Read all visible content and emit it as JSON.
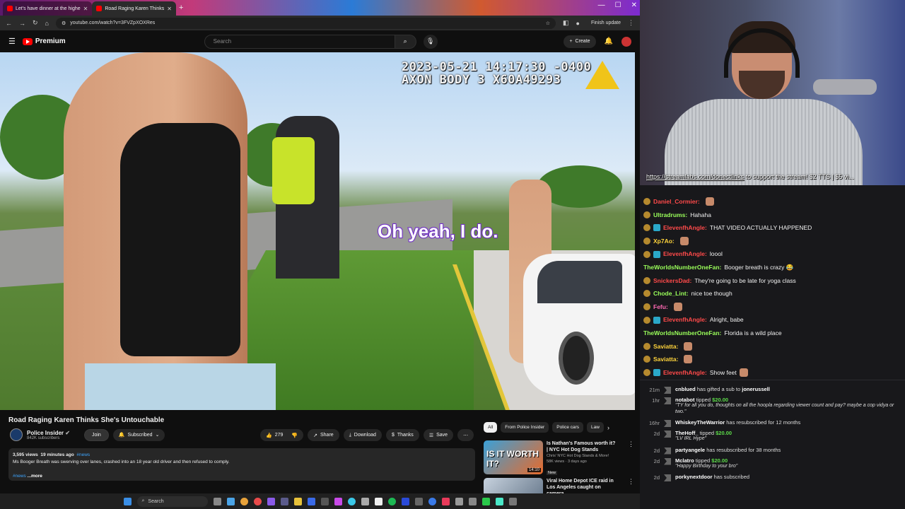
{
  "browser": {
    "tabs": [
      {
        "label": "Let's have dinner at the highe"
      },
      {
        "label": "Road Raging Karen Thinks"
      }
    ],
    "new_tab": "+",
    "window": {
      "min": "—",
      "max": "☐",
      "close": "✕"
    },
    "url": "youtube.com/watch?v=3FVZpXOXRes",
    "finish_update": "Finish update"
  },
  "yt": {
    "brand": "Premium",
    "search_placeholder": "Search",
    "create": "Create"
  },
  "video": {
    "timestamp_line1": "2023-05-21 14:17:30 -0400",
    "timestamp_line2": "AXON BODY 3 X60A49293",
    "caption": "Oh yeah, I do."
  },
  "info": {
    "title": "Road Raging Karen Thinks She's Untouchable",
    "channel": "Police Insider",
    "subscribers": "842K subscribers",
    "join": "Join",
    "subscribed": "Subscribed",
    "likes": "279",
    "share": "Share",
    "download": "Download",
    "thanks": "Thanks",
    "save": "Save",
    "views": "3,595 views",
    "age": "19 minutes ago",
    "tag": "#news",
    "description": "Ms Booger Breath was swerving over lanes, crashed into an 18 year old driver and then refused to comply.",
    "tag2": "#news",
    "more": "...more"
  },
  "chips": [
    "All",
    "From Police Insider",
    "Police cars",
    "Law"
  ],
  "recommended": [
    {
      "title": "Is Nathan's Famous worth it? | NYC Hot Dog Stands",
      "channel": "Chris' NYC Hot Dog Stands & More!",
      "meta": "58K views · 3 days ago",
      "badge": "New",
      "duration": "14:10",
      "thumb_text": "IS IT WORTH IT?"
    },
    {
      "title": "Viral Home Depot ICE raid in Los Angeles caught on camera",
      "channel": "",
      "meta": "",
      "badge": "",
      "duration": "",
      "thumb_text": ""
    }
  ],
  "stream": {
    "ticker_link": "https://streamlabs.com/donectlinks",
    "ticker_text": " to support the stream! $2 TTS | $5 vi..."
  },
  "chat": [
    {
      "user": "Daniel_Cormier:",
      "color": "#ff4a4a",
      "text": "",
      "emote": true,
      "badge": "gold"
    },
    {
      "user": "Ultradrums:",
      "color": "#9aff5a",
      "text": "Hahaha",
      "emote": false,
      "badge": "gold"
    },
    {
      "user": "ElevenfhAngle:",
      "color": "#ff4a4a",
      "text": "THAT VIDEO ACTUALLY HAPPENED",
      "emote": false,
      "badge": "both"
    },
    {
      "user": "Xp7Ao:",
      "color": "#ffd43b",
      "text": "",
      "emote": true,
      "badge": "gold"
    },
    {
      "user": "ElevenfhAngle:",
      "color": "#ff4a4a",
      "text": "loool",
      "emote": false,
      "badge": "both"
    },
    {
      "user": "TheWorldsNumberOneFan:",
      "color": "#9aff5a",
      "text": "Booger breath is crazy 😂",
      "emote": false,
      "badge": "none"
    },
    {
      "user": "SnickersDad:",
      "color": "#ff4a4a",
      "text": "They're going to be late for yoga class",
      "emote": false,
      "badge": "gold"
    },
    {
      "user": "Chode_Lint:",
      "color": "#9aff5a",
      "text": "nice toe though",
      "emote": false,
      "badge": "gold"
    },
    {
      "user": "Fefu:",
      "color": "#ff69b4",
      "text": "",
      "emote": true,
      "badge": "gold"
    },
    {
      "user": "ElevenfhAngle:",
      "color": "#ff4a4a",
      "text": "Alright, babe",
      "emote": false,
      "badge": "both"
    },
    {
      "user": "TheWorldsNumberOneFan:",
      "color": "#9aff5a",
      "text": "Florida is a wild place",
      "emote": false,
      "badge": "none"
    },
    {
      "user": "Saviatta:",
      "color": "#ffd43b",
      "text": "",
      "emote": true,
      "badge": "gold"
    },
    {
      "user": "Saviatta:",
      "color": "#ffd43b",
      "text": "",
      "emote": true,
      "badge": "gold"
    },
    {
      "user": "ElevenfhAngle:",
      "color": "#ff4a4a",
      "text": "Show feet",
      "emote": true,
      "badge": "both"
    }
  ],
  "events": [
    {
      "age": "21m",
      "name": "cnblued",
      "action": " has gifted a sub to ",
      "target": "jonerussell",
      "amount": "",
      "msg": ""
    },
    {
      "age": "1hr",
      "name": "notabot",
      "action": " tipped ",
      "target": "",
      "amount": "$20.00",
      "msg": "\"TY for all you do, thoughts on all the hoopla regarding viewer count and pay? maybe a cop vidya or two.\""
    },
    {
      "age": "16hr",
      "name": "WhiskeyTheWarrior",
      "action": " has resubscribed for 12 months",
      "target": "",
      "amount": "",
      "msg": ""
    },
    {
      "age": "2d",
      "name": "TheHoff_",
      "action": " tipped ",
      "target": "",
      "amount": "$20.00",
      "msg": "\"LV IRL Hype\""
    },
    {
      "age": "2d",
      "name": "partyangele",
      "action": " has resubscribed for 38 months",
      "target": "",
      "amount": "",
      "msg": ""
    },
    {
      "age": "2d",
      "name": "Mclatro",
      "action": " tipped ",
      "target": "",
      "amount": "$20.00",
      "msg": "\"Happy Birthday to your bro\""
    },
    {
      "age": "2d",
      "name": "porkynextdoor",
      "action": " has subscribed",
      "target": "",
      "amount": "",
      "msg": ""
    }
  ],
  "taskbar": {
    "search": "Search"
  }
}
